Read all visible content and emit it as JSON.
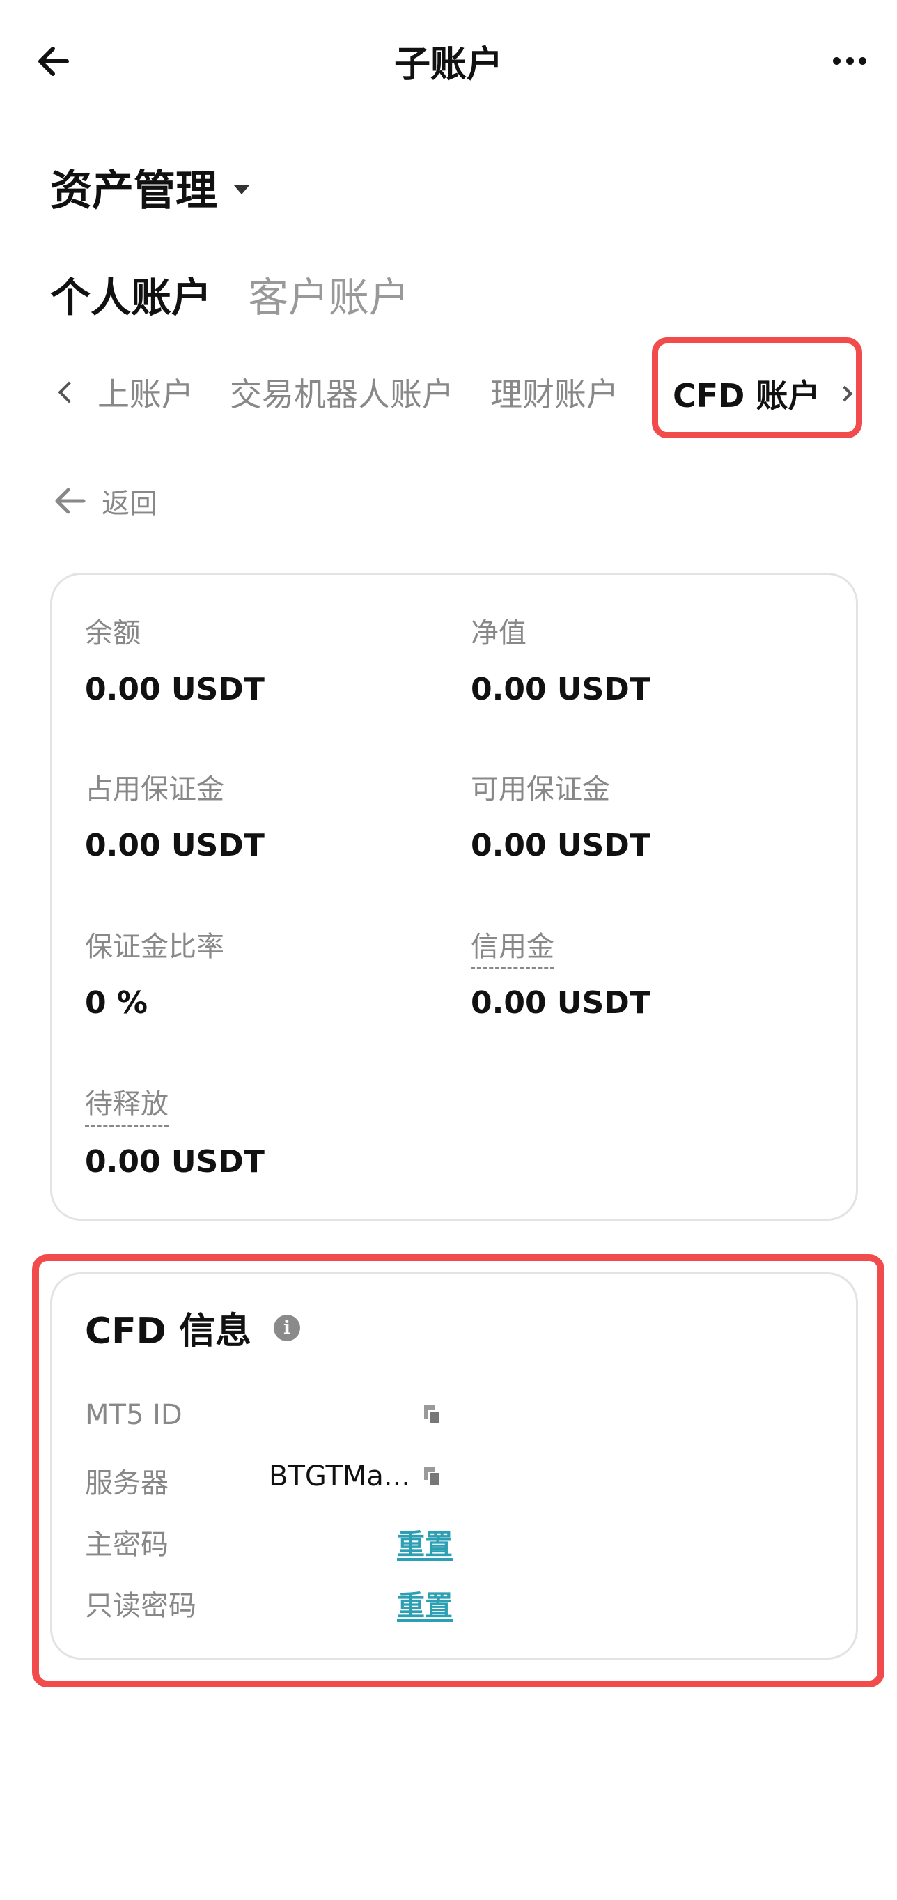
{
  "header": {
    "title": "子账户",
    "back_icon": "back-arrow-icon",
    "more_icon": "more-horizontal-icon"
  },
  "asset": {
    "title": "资产管理"
  },
  "account_tabs": [
    {
      "label": "个人账户",
      "active": true
    },
    {
      "label": "客户账户",
      "active": false
    }
  ],
  "sub_tabs": {
    "items": [
      "上账户",
      "交易机器人账户",
      "理财账户"
    ],
    "active": "CFD 账户"
  },
  "return": {
    "label": "返回"
  },
  "balance": {
    "balance_label": "余额",
    "balance_value": "0.00 USDT",
    "equity_label": "净值",
    "equity_value": "0.00 USDT",
    "used_margin_label": "占用保证金",
    "used_margin_value": "0.00 USDT",
    "free_margin_label": "可用保证金",
    "free_margin_value": "0.00 USDT",
    "margin_ratio_label": "保证金比率",
    "margin_ratio_value": "0 %",
    "credit_label": "信用金",
    "credit_value": "0.00 USDT",
    "pending_label": "待释放",
    "pending_value": "0.00 USDT"
  },
  "cfd_info": {
    "title": "CFD 信息",
    "mt5_label": "MT5 ID",
    "mt5_value": "",
    "server_label": "服务器",
    "server_value": "BTGTMa...",
    "master_pw_label": "主密码",
    "master_pw_action": "重置",
    "readonly_pw_label": "只读密码",
    "readonly_pw_action": "重置"
  },
  "colors": {
    "highlight": "#f24b4b",
    "link": "#2b9fb3"
  }
}
